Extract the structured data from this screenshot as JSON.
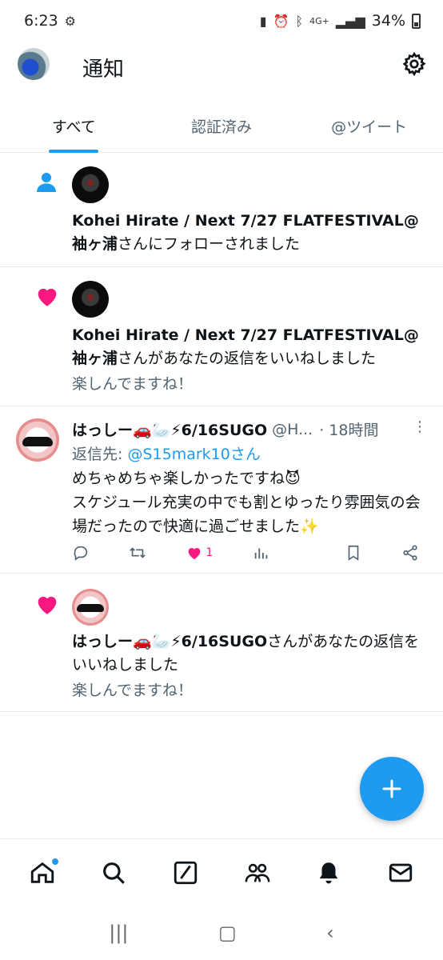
{
  "status_bar": {
    "time": "6:23",
    "network": "4G+",
    "battery": "34%"
  },
  "header": {
    "title": "通知"
  },
  "tabs": [
    {
      "label": "すべて"
    },
    {
      "label": "認証済み"
    },
    {
      "label": "@ツイート"
    }
  ],
  "notifications": [
    {
      "type": "follow",
      "name": "Kohei Hirate / Next 7/27 FLATFESTIVAL@袖ヶ浦",
      "action": "さんにフォローされました"
    },
    {
      "type": "like",
      "name": "Kohei Hirate / Next 7/27 FLATFESTIVAL@袖ヶ浦",
      "action": "さんがあなたの返信をいいねしました",
      "snippet": "楽しんでますね！"
    },
    {
      "type": "tweet",
      "name": "はっしー🚗🦢⚡6/16SUGO",
      "handle": "@H...",
      "time": "· 18時間",
      "reply_label": "返信先: ",
      "reply_to": "@S15mark10さん",
      "body_line1": "めちゃめちゃ楽しかったですね😈",
      "body_line2": "スケジュール充実の中でも割とゆったり雰囲気の会場だったので快適に過ごせました✨",
      "like_count": "1"
    },
    {
      "type": "like",
      "name": "はっしー🚗🦢⚡6/16SUGO",
      "action": "さんがあなたの返信をいいねしました",
      "snippet": "楽しんでますね！"
    }
  ],
  "colors": {
    "accent": "#1d9bf0",
    "like": "#f91880",
    "text": "#0f1419",
    "muted": "#536471"
  }
}
